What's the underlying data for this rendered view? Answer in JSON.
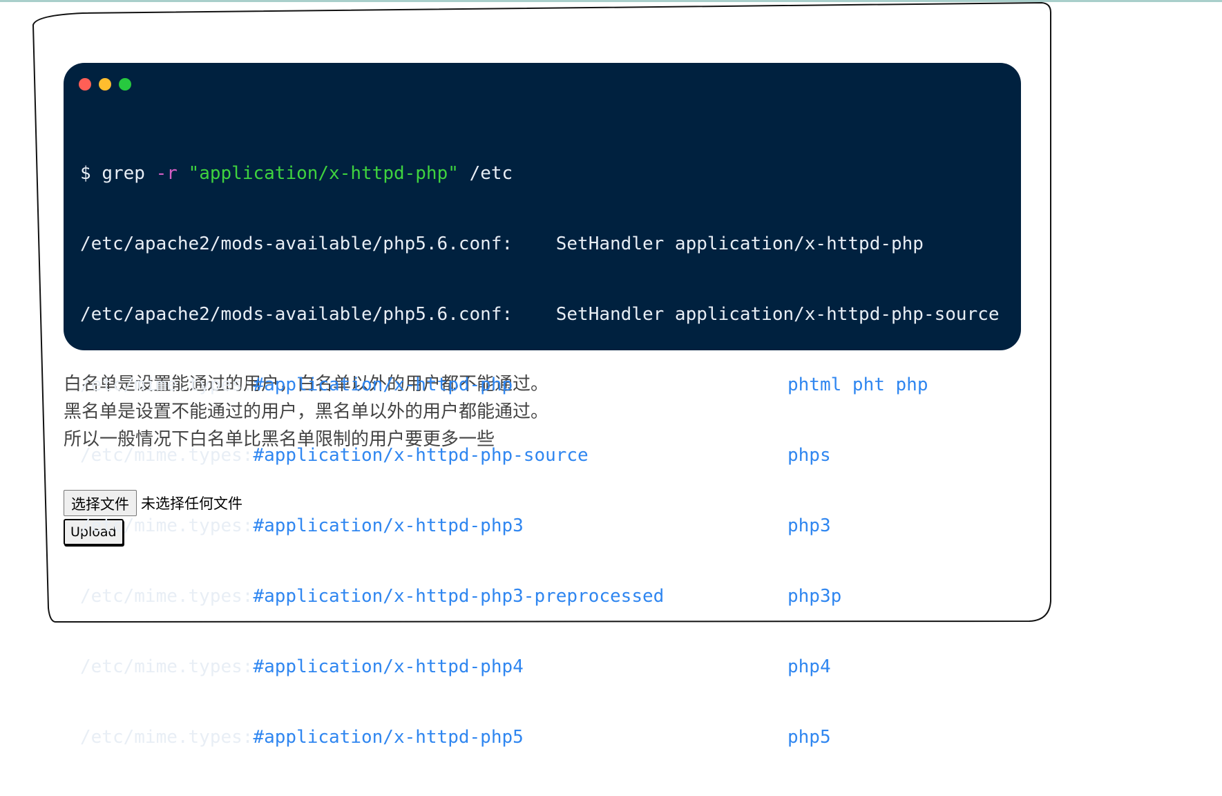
{
  "terminal": {
    "command": {
      "prompt": "$",
      "cmd": "grep",
      "flag": "-r",
      "pattern": "\"application/x-httpd-php\"",
      "path": "/etc"
    },
    "output": [
      {
        "text": "/etc/apache2/mods-available/php5.6.conf:    SetHandler application/x-httpd-php"
      },
      {
        "text": "/etc/apache2/mods-available/php5.6.conf:    SetHandler application/x-httpd-php-source"
      }
    ],
    "mime_prefix": "/etc/mime.types:",
    "mime_lines": [
      {
        "type": "#application/x-httpd-php",
        "ext": "phtml pht php"
      },
      {
        "type": "#application/x-httpd-php-source",
        "ext": "phps"
      },
      {
        "type": "#application/x-httpd-php3",
        "ext": "php3"
      },
      {
        "type": "#application/x-httpd-php3-preprocessed",
        "ext": "php3p"
      },
      {
        "type": "#application/x-httpd-php4",
        "ext": "php4"
      },
      {
        "type": "#application/x-httpd-php5",
        "ext": "php5"
      }
    ]
  },
  "notes": [
    "白名单是设置能通过的用户，白名单以外的用户都不能通过。",
    "黑名单是设置不能通过的用户，黑名单以外的用户都能通过。",
    "所以一般情况下白名单比黑名单限制的用户要更多一些"
  ],
  "upload": {
    "choose_label": "选择文件",
    "status": "未选择任何文件",
    "submit_label": "Upload"
  },
  "colors": {
    "terminal_bg": "#00213f",
    "flag": "#d65fc5",
    "string": "#3fd33f",
    "comment_blue": "#2f86f0"
  }
}
